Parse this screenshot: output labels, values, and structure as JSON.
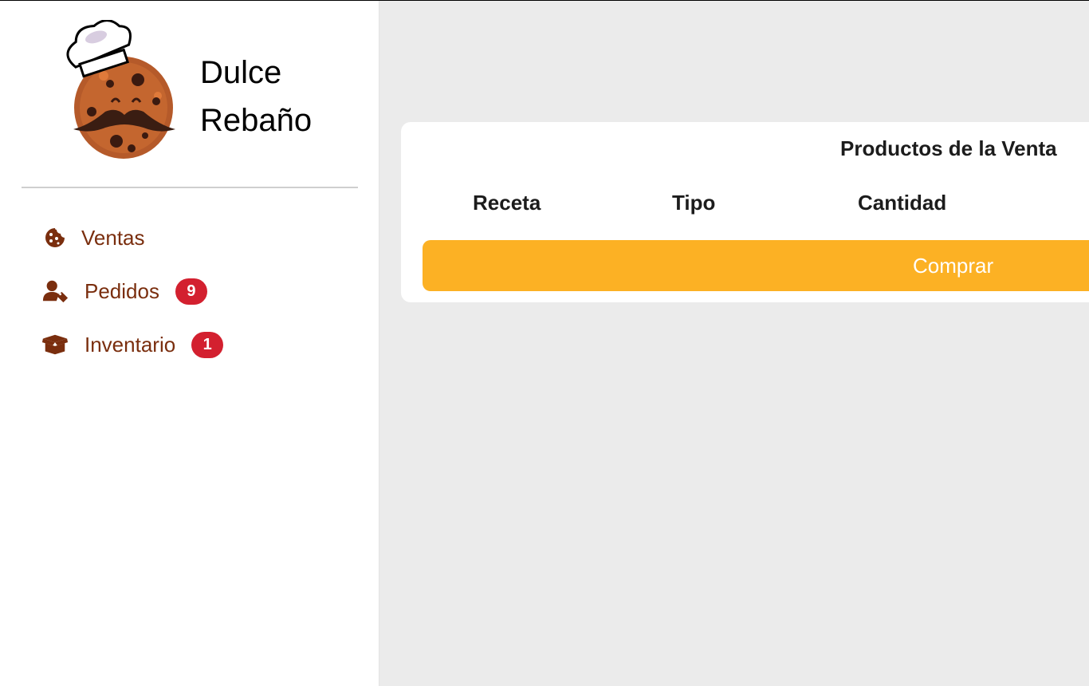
{
  "brand": {
    "name_line1": "Dulce",
    "name_line2": "Rebaño"
  },
  "sidebar": {
    "items": [
      {
        "label": "Ventas",
        "icon": "cookie-icon",
        "badge": null
      },
      {
        "label": "Pedidos",
        "icon": "user-tag-icon",
        "badge": "9"
      },
      {
        "label": "Inventario",
        "icon": "box-open-icon",
        "badge": "1"
      }
    ]
  },
  "sale": {
    "title": "Productos de la Venta",
    "columns": [
      "Receta",
      "Tipo",
      "Cantidad"
    ],
    "buy_label": "Comprar"
  },
  "colors": {
    "accent": "#fcb124",
    "nav_text": "#7a2e0e",
    "badge": "#d3202f",
    "background": "#ebebeb"
  }
}
